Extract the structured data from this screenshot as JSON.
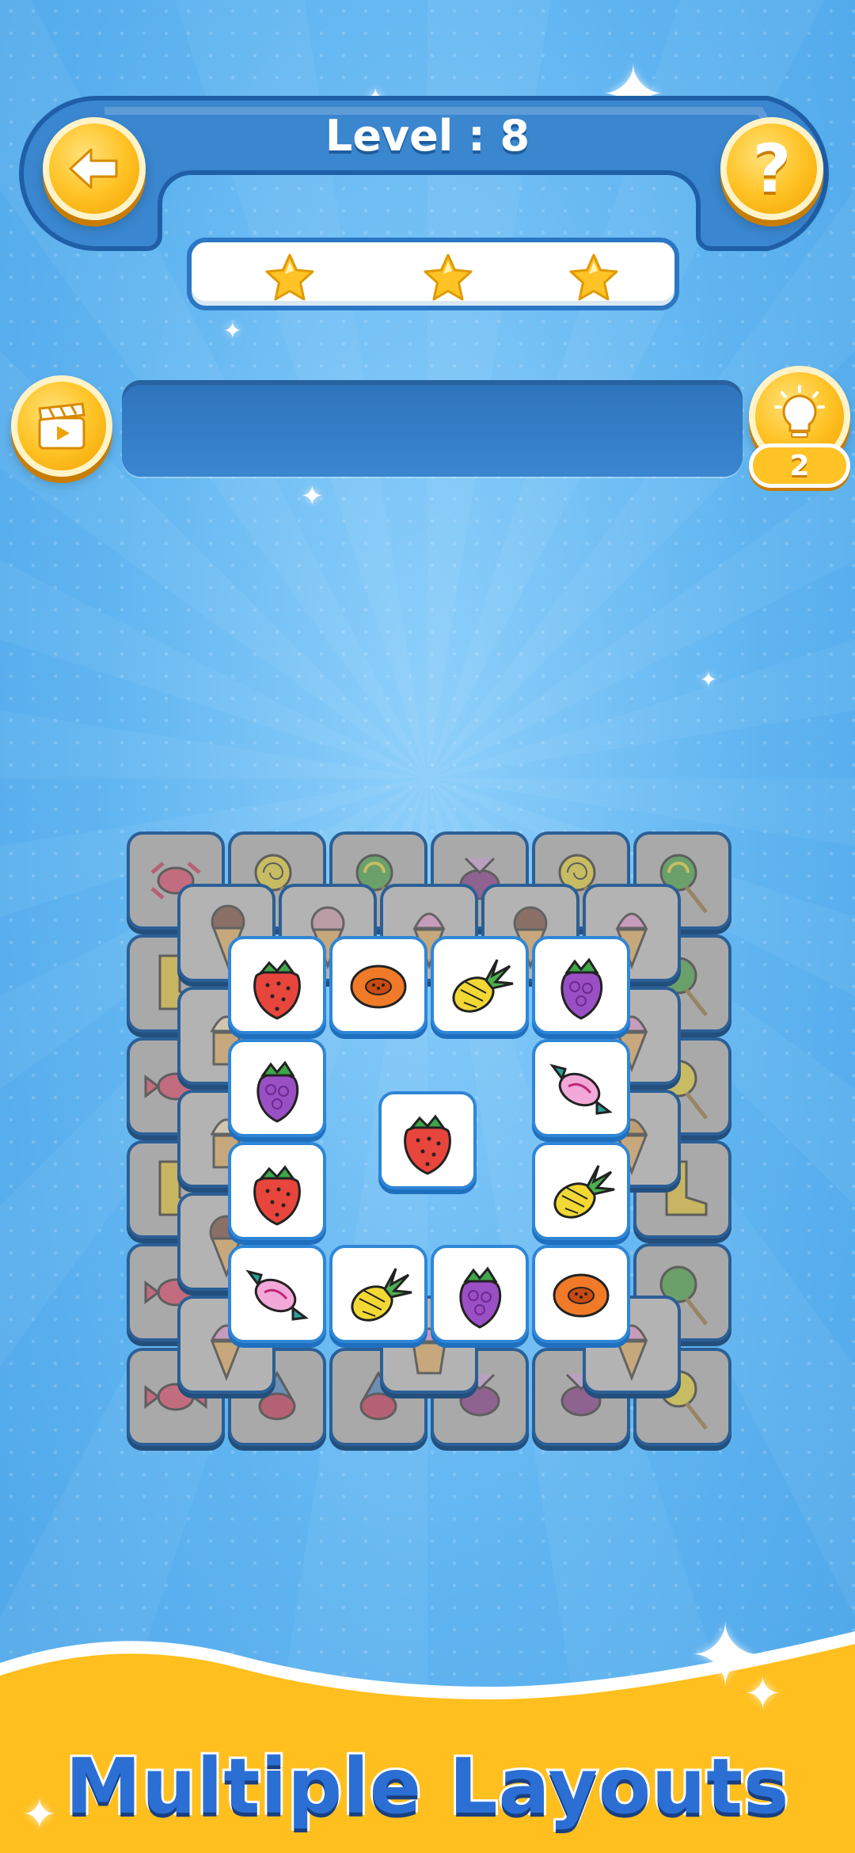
{
  "level": {
    "title": "Level : 8"
  },
  "stars": {
    "count": 3,
    "color": "#ffc326"
  },
  "hint": {
    "count": "2"
  },
  "help": {
    "symbol": "?"
  },
  "buttons": {
    "back": {
      "icon": "arrow-left-icon"
    },
    "help": {
      "icon": "question-icon"
    },
    "video": {
      "icon": "clapperboard-icon"
    },
    "hint": {
      "icon": "lightbulb-icon"
    }
  },
  "board": {
    "bottom_layer": [
      "candy",
      "lollipop",
      "lollipop",
      "candy",
      "lollipop",
      "lollipop",
      "boot",
      "lollipop",
      "candy",
      "lollipop",
      "boot",
      "boot",
      "candy",
      "candy",
      "candy",
      "candy",
      "candy",
      "lollipop"
    ],
    "middle_layer": [
      "ice-cream",
      "ice-cream",
      "ice-cream",
      "ice-cream",
      "ice-cream",
      "ice-cream",
      "ice-cream",
      "ice-cream",
      "ice-cream",
      "ice-cream",
      "cupcake",
      "ice-cream"
    ],
    "top_layer": [
      [
        "strawberry",
        "papaya",
        "pineapple",
        "grapes"
      ],
      [
        "grapes",
        "candy"
      ],
      [
        "strawberry",
        "pineapple"
      ],
      [
        "candy",
        "pineapple",
        "grapes",
        "papaya"
      ]
    ],
    "center_tile": "strawberry"
  },
  "banner": {
    "text": "Multiple Layouts",
    "color": "#ffc326"
  },
  "colors": {
    "background": "#5fb4f0",
    "header": "#3a86cf",
    "gold": "#ffc326"
  }
}
